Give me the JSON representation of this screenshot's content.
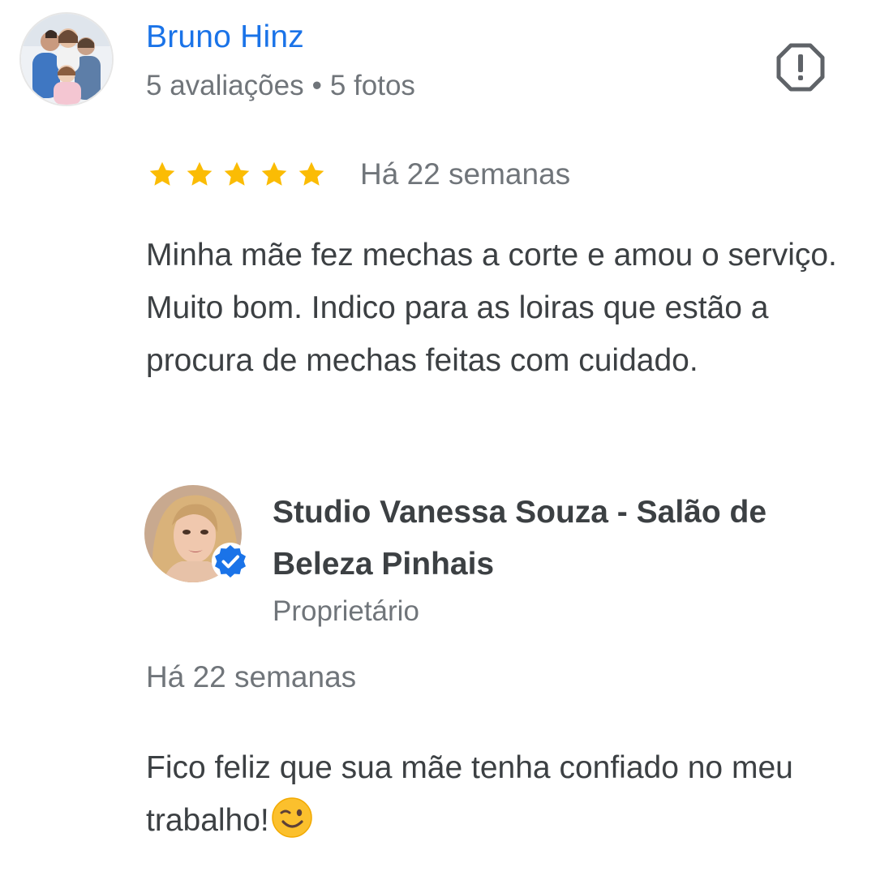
{
  "review": {
    "reviewer": {
      "name": "Bruno Hinz",
      "reviews_count": "5 avaliações",
      "separator": "•",
      "photos_count": "5 fotos",
      "avatar_icon": "family-photo-avatar"
    },
    "report_icon": "report-octagon-icon",
    "rating": 5,
    "max_rating": 5,
    "star_color": "#fbbc04",
    "date": "Há 22 semanas",
    "text": "Minha mãe fez mechas a corte e amou o serviço. Muito bom. Indico para as loiras que estão a procura de mechas feitas com cuidado."
  },
  "owner_reply": {
    "owner_name": "Studio Vanessa Souza - Salão de Beleza Pinhais",
    "role": "Proprietário",
    "verified_icon": "verified-badge-icon",
    "date": "Há 22 semanas",
    "text": "Fico feliz que sua mãe tenha confiado no meu trabalho!",
    "emoji": "winking-face-emoji"
  },
  "colors": {
    "link_blue": "#1a73e8",
    "secondary_text": "#70757a",
    "primary_text": "#3c4043",
    "verified_blue": "#1a73e8"
  }
}
